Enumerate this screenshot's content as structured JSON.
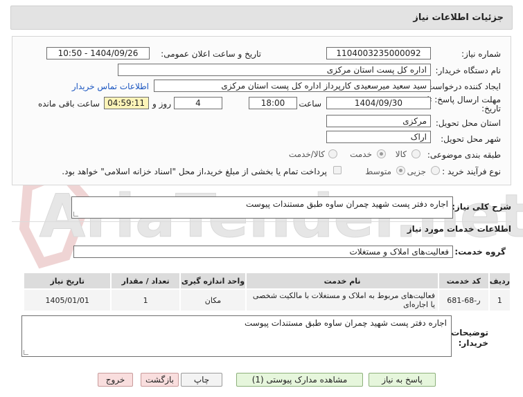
{
  "header": {
    "title": "جزئیات اطلاعات نیاز"
  },
  "watermark": {
    "text": "AriaTender.net"
  },
  "form": {
    "need_number_label": "شماره نیاز:",
    "need_number": "1104003235000092",
    "announce_label": "تاریخ و ساعت اعلان عمومی:",
    "announce_value": "1404/09/26 - 10:50",
    "buyer_label": "نام دستگاه خریدار:",
    "buyer_value": "اداره کل پست استان مرکزی",
    "creator_label": "ایجاد کننده درخواست:",
    "creator_value": "سید سعید میرسعیدی کارپرداز اداره کل پست استان مرکزی",
    "contact_link": "اطلاعات تماس خریدار",
    "deadline_label_1": "مهلت ارسال پاسخ: تا",
    "deadline_label_2": "تاریخ:",
    "deadline_date": "1404/09/30",
    "time_label": "ساعت",
    "deadline_time": "18:00",
    "days_value": "4",
    "days_label": "روز و",
    "remaining_value": "04:59:11",
    "remaining_label": "ساعت باقی مانده",
    "province_label": "استان محل تحویل:",
    "province_value": "مرکزی",
    "city_label": "شهر محل تحویل:",
    "city_value": "اراک",
    "category_label": "طبقه بندی موضوعی:",
    "category_options": [
      "کالا",
      "خدمت",
      "کالا/خدمت"
    ],
    "category_selected": "خدمت",
    "process_label": "نوع فرآیند خرید :",
    "process_options": [
      "جزیی",
      "متوسط"
    ],
    "process_selected": "متوسط",
    "payment_note": "پرداخت تمام یا بخشی از مبلغ خرید،از محل \"اسناد خزانه اسلامی\" خواهد بود."
  },
  "summary": {
    "label": "شرح کلی نیاز:",
    "value": "اجاره دفتر پست شهید چمران ساوه طبق مستندات پیوست"
  },
  "services": {
    "section_title": "اطلاعات خدمات مورد نیاز",
    "group_label": "گروه خدمت:",
    "group_value": "فعالیت‌های  املاک و مستغلات",
    "columns": [
      "ردیف",
      "کد خدمت",
      "نام خدمت",
      "واحد اندازه گیری",
      "تعداد / مقدار",
      "تاریخ نیاز"
    ],
    "rows": [
      [
        "1",
        "ر-68-681",
        "فعالیت‌های مربوط به املاک و مستغلات با مالکیت شخصی یا اجاره‌ای",
        "مکان",
        "1",
        "1405/01/01"
      ]
    ]
  },
  "buyer_notes": {
    "label_1": "توضیحات",
    "label_2": "خریدار:",
    "value": "اجاره دفتر پست شهید چمران ساوه طبق مستندات پیوست"
  },
  "buttons": {
    "reply": "پاسخ به نیاز",
    "view_docs": "مشاهده مدارک پیوستی (1)",
    "print": "چاپ",
    "back": "بازگشت",
    "exit": "خروج"
  }
}
